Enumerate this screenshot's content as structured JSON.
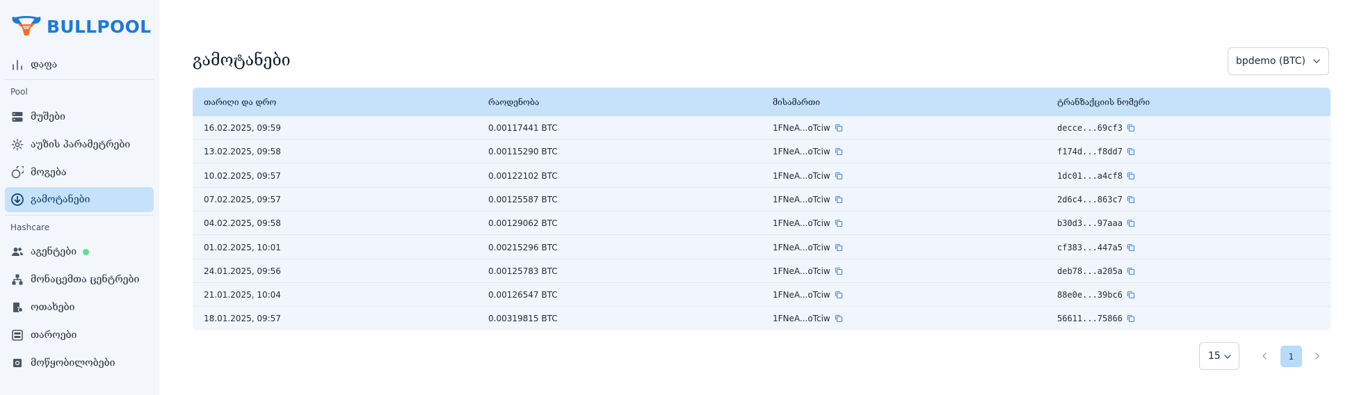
{
  "brand": {
    "name": "BULLPOOL"
  },
  "sidebar": {
    "top_item": {
      "label": "დაფა",
      "icon": "bar-chart-icon"
    },
    "section_pool": "Pool",
    "pool_items": [
      {
        "label": "მუშები",
        "icon": "server-icon"
      },
      {
        "label": "აუზის პარამეტრები",
        "icon": "gear-icon"
      },
      {
        "label": "მოგება",
        "icon": "coins-icon"
      },
      {
        "label": "გამოტანები",
        "icon": "download-circle-icon",
        "active": true
      }
    ],
    "section_hashcare": "Hashcare",
    "hashcare_items": [
      {
        "label": "აგენტები",
        "icon": "users-icon",
        "status": "online"
      },
      {
        "label": "მონაცემთა ცენტრები",
        "icon": "network-icon"
      },
      {
        "label": "ოთახები",
        "icon": "room-icon"
      },
      {
        "label": "თაროები",
        "icon": "rack-icon"
      },
      {
        "label": "მოწყობილობები",
        "icon": "chip-icon"
      }
    ]
  },
  "main": {
    "title": "გამოტანები",
    "account_select": "bpdemo (BTC)",
    "table": {
      "headers": [
        "თარიღი და დრო",
        "რაოდენობა",
        "მისამართი",
        "ტრანზაქციის ნომერი"
      ],
      "rows": [
        {
          "date": "16.02.2025, 09:59",
          "amount": "0.00117441 BTC",
          "address": "1FNeA...oTciw",
          "tx": "decce...69cf3"
        },
        {
          "date": "13.02.2025, 09:58",
          "amount": "0.00115290 BTC",
          "address": "1FNeA...oTciw",
          "tx": "f174d...f8dd7"
        },
        {
          "date": "10.02.2025, 09:57",
          "amount": "0.00122102 BTC",
          "address": "1FNeA...oTciw",
          "tx": "1dc01...a4cf8"
        },
        {
          "date": "07.02.2025, 09:57",
          "amount": "0.00125587 BTC",
          "address": "1FNeA...oTciw",
          "tx": "2d6c4...863c7"
        },
        {
          "date": "04.02.2025, 09:58",
          "amount": "0.00129062 BTC",
          "address": "1FNeA...oTciw",
          "tx": "b30d3...97aaa"
        },
        {
          "date": "01.02.2025, 10:01",
          "amount": "0.00215296 BTC",
          "address": "1FNeA...oTciw",
          "tx": "cf383...447a5"
        },
        {
          "date": "24.01.2025, 09:56",
          "amount": "0.00125783 BTC",
          "address": "1FNeA...oTciw",
          "tx": "deb78...a205a"
        },
        {
          "date": "21.01.2025, 10:04",
          "amount": "0.00126547 BTC",
          "address": "1FNeA...oTciw",
          "tx": "88e0e...39bc6"
        },
        {
          "date": "18.01.2025, 09:57",
          "amount": "0.00319815 BTC",
          "address": "1FNeA...oTciw",
          "tx": "56611...75866"
        }
      ]
    },
    "pagination": {
      "per_page": "15",
      "current_page": "1"
    }
  },
  "colors": {
    "accent": "#1e7ad8",
    "active_bg": "#c6e2fb",
    "header_bg": "#c6e2fb",
    "row_bg": "#f1f6fc",
    "online": "#4ade80"
  }
}
